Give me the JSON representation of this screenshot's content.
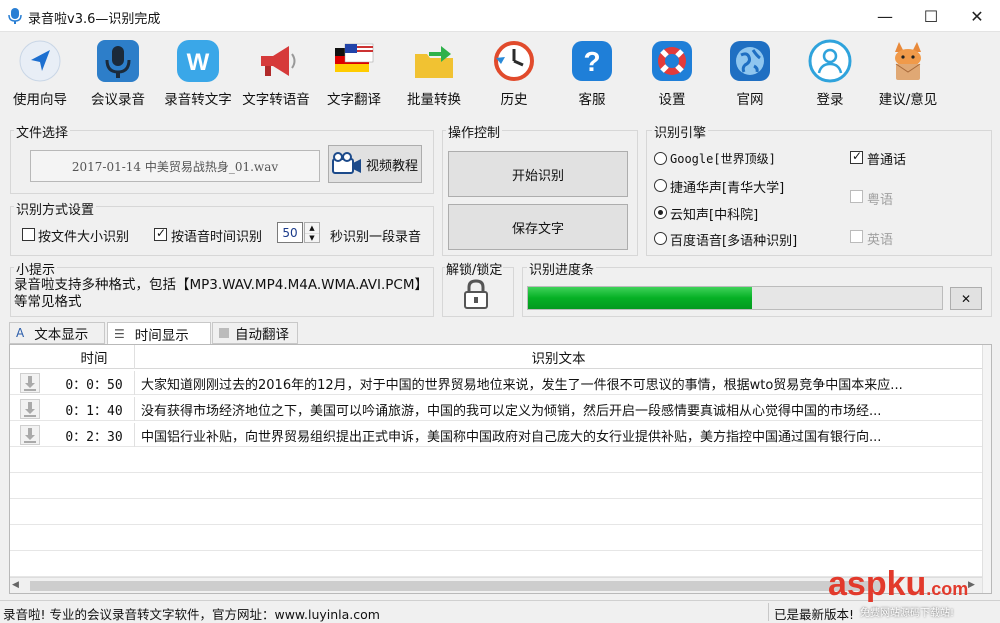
{
  "window": {
    "title": "录音啦v3.6—识别完成",
    "minimize": "—",
    "maximize": "☐",
    "close": "✕"
  },
  "toolbar": [
    {
      "label": "使用向导",
      "icon": "navigation-arrow-icon"
    },
    {
      "label": "会议录音",
      "icon": "microphone-icon"
    },
    {
      "label": "录音转文字",
      "icon": "w-badge-icon"
    },
    {
      "label": "文字转语音",
      "icon": "megaphone-icon"
    },
    {
      "label": "文字翻译",
      "icon": "flags-icon"
    },
    {
      "label": "批量转换",
      "icon": "folder-arrow-icon"
    },
    {
      "label": "历史",
      "icon": "history-clock-icon"
    },
    {
      "label": "客服",
      "icon": "help-question-icon"
    },
    {
      "label": "设置",
      "icon": "lifebuoy-icon"
    },
    {
      "label": "官网",
      "icon": "globe-icon"
    },
    {
      "label": "登录",
      "icon": "user-icon"
    },
    {
      "label": "建议/意见",
      "icon": "cat-mailbox-icon"
    }
  ],
  "file_select": {
    "title": "文件选择",
    "file_name": "2017-01-14 中美贸易战热身_01.wav",
    "video_tutorial": "视频教程"
  },
  "recognition_mode": {
    "title": "识别方式设置",
    "by_file_size": "按文件大小识别",
    "by_file_size_checked": false,
    "by_voice_time": "按语音时间识别",
    "by_voice_time_checked": true,
    "seconds_value": "50",
    "seconds_suffix": "秒识别一段录音"
  },
  "operation": {
    "title": "操作控制",
    "start": "开始识别",
    "save": "保存文字"
  },
  "engine": {
    "title": "识别引擎",
    "options": [
      {
        "label": "Google[世界顶级]",
        "selected": false
      },
      {
        "label": "捷通华声[青华大学]",
        "selected": false
      },
      {
        "label": "云知声[中科院]",
        "selected": true
      },
      {
        "label": "百度语音[多语种识别]",
        "selected": false
      }
    ],
    "languages": [
      {
        "label": "普通话",
        "checked": true,
        "enabled": true
      },
      {
        "label": "粤语",
        "checked": false,
        "enabled": false
      },
      {
        "label": "英语",
        "checked": false,
        "enabled": false
      }
    ]
  },
  "tips": {
    "title": "小提示",
    "text": "录音啦支持多种格式，包括【MP3.WAV.MP4.M4A.WMA.AVI.PCM】等常见格式"
  },
  "lock": {
    "title": "解锁/锁定"
  },
  "progress": {
    "title": "识别进度条",
    "value": 0.54,
    "cancel": "✕"
  },
  "tabs": [
    {
      "label": "文本显示",
      "icon": "text-a-icon",
      "active": false
    },
    {
      "label": "时间显示",
      "icon": "list-icon",
      "active": true
    },
    {
      "label": "自动翻译",
      "icon": "translate-icon",
      "active": false
    }
  ],
  "table": {
    "headers": [
      "时间",
      "识别文本"
    ],
    "rows": [
      {
        "time": "0：0：50",
        "text": "大家知道刚刚过去的2016年的12月，对于中国的世界贸易地位来说，发生了一件很不可思议的事情，根据wto贸易竞争中国本来应..."
      },
      {
        "time": "0：1：40",
        "text": "没有获得市场经济地位之下，美国可以吟诵旅游，中国的我可以定义为倾销，然后开启一段感情要真诚相从心觉得中国的市场经..."
      },
      {
        "time": "0：2：30",
        "text": "中国铝行业补贴，向世界贸易组织提出正式申诉，美国称中国政府对自己庞大的女行业提供补贴，美方指控中国通过国有银行向..."
      }
    ]
  },
  "status": {
    "left": "录音啦! 专业的会议录音转文字软件，官方网址：www.luyinla.com",
    "right": "已是最新版本!",
    "watermark_main": "aspku",
    "watermark_tld": ".com",
    "watermark_sub": "免费网站源码下载站!"
  },
  "colors": {
    "progress": "#06b025",
    "accent": "#2a7fd4"
  }
}
